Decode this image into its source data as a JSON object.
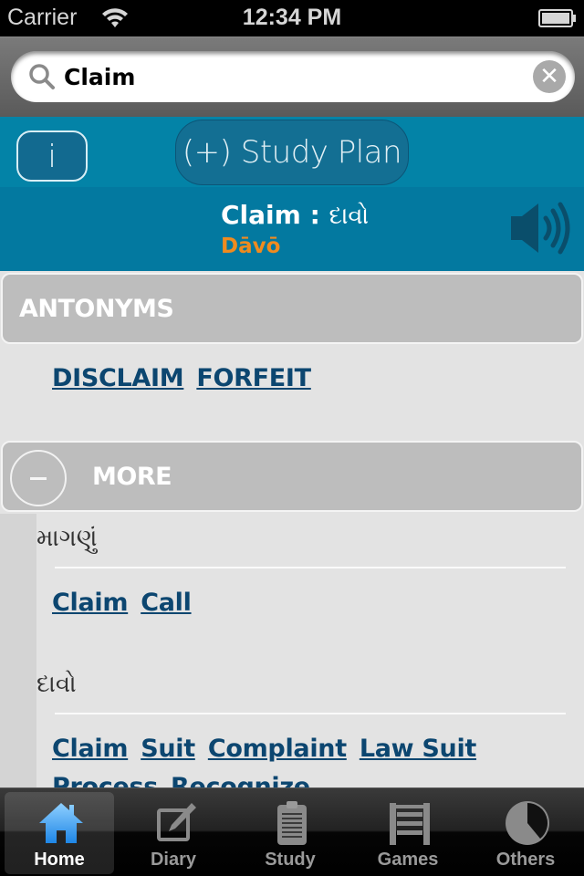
{
  "status_bar": {
    "carrier": "Carrier",
    "time": "12:34 PM",
    "wifi_icon": "wifi-icon",
    "battery_icon": "battery-icon"
  },
  "search": {
    "value": "Claim",
    "icon": "search-icon",
    "clear_icon": "clear-icon",
    "clear_glyph": "✕"
  },
  "actions": {
    "info_label": "i",
    "study_plan_label": "(+) Study Plan"
  },
  "word": {
    "english": "Claim",
    "separator": " : ",
    "translation": "દાવો",
    "transliteration": "Dāvō",
    "speaker_icon": "speaker-icon"
  },
  "antonyms": {
    "title": "ANTONYMS",
    "items": [
      "DISCLAIM",
      "FORFEIT"
    ]
  },
  "more": {
    "title": "MORE",
    "groups": [
      {
        "heading": "માગણું",
        "links": [
          "Claim",
          "Call"
        ]
      },
      {
        "heading": "દાવો",
        "links": [
          "Claim",
          "Suit",
          "Complaint",
          "Law Suit"
        ],
        "links_continued": [
          "Process",
          "Recognize"
        ]
      }
    ]
  },
  "tabs": [
    {
      "label": "Home",
      "icon": "home-icon",
      "active": true
    },
    {
      "label": "Diary",
      "icon": "diary-icon",
      "active": false
    },
    {
      "label": "Study",
      "icon": "clipboard-icon",
      "active": false
    },
    {
      "label": "Games",
      "icon": "abacus-icon",
      "active": false
    },
    {
      "label": "Others",
      "icon": "pie-icon",
      "active": false
    }
  ],
  "colors": {
    "action_strip": "#0383a7",
    "word_header": "#0379a0",
    "transliteration": "#f08b1f",
    "link": "#0c4670",
    "section_header": "#bdbdbd",
    "content_bg": "#e3e3e3",
    "tab_active_icon": "#3aa2ef"
  }
}
